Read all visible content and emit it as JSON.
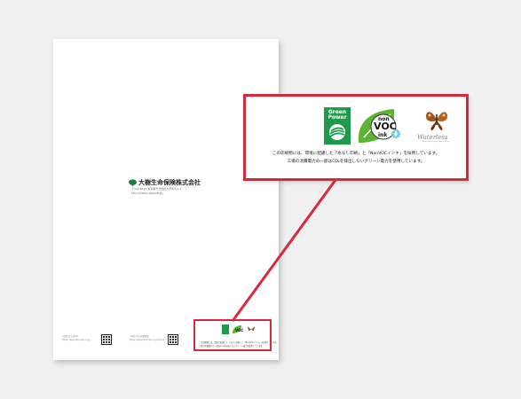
{
  "company": {
    "name": "大樹生命保険株式会社",
    "address_line1": "〒100-8123 東京都千代田区大手町1-1-1",
    "address_line2": "TEL 03-6831-8000(代表)"
  },
  "footer": {
    "left_caption": "大樹生命公式HP",
    "left_url": "https://www.taiju-life.co.jp/",
    "right_caption": "大樹生命の各種情報",
    "right_url": "https://www.taiju-life.co.jp/about/"
  },
  "logos": {
    "green_power_line1": "Green",
    "green_power_line2": "Power",
    "nonvoc_line1": "non",
    "nonvoc_line2": "VOC",
    "nonvoc_line3": "ink",
    "butterfly_script": "Waterless",
    "butterfly_sub": "Waterless Printing Association"
  },
  "callout": {
    "line1": "この印刷物には、環境に配慮した「水なし印刷」と「NonVOCインキ」を採用しています。",
    "line2": "工場の消費電力の一部はCO₂を排出しないグリーン電力を使用しています。"
  },
  "colors": {
    "highlight_border": "#d62a3c",
    "green_power": "#1f9a4a",
    "nonvoc_green": "#5bb531",
    "brand_green": "#1a7a3a"
  }
}
